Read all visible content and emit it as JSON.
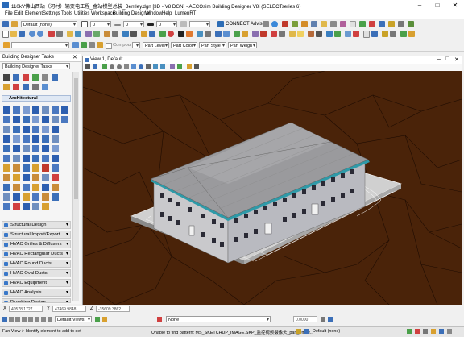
{
  "title": "110kV佛山西站（河村）输变电工程_金站模型总装_Bentley.dgn [3D - V8 DGN] - AECOsim Building Designer V8i (SELECTseries 6)",
  "menu": [
    "File",
    "Edit",
    "Element",
    "Settings",
    "Tools",
    "Utilities",
    "Workspace",
    "Building Designer",
    "Window",
    "Help",
    "LumenRT"
  ],
  "toolbar": {
    "level_display": "Default (none)",
    "color_value": "0",
    "style_value": "0",
    "weight_value": "0",
    "connect_label": "CONNECT Advisor",
    "compound_label": "Compound",
    "part_level": "Part Level",
    "part_color": "Part Color",
    "part_style": "Part Style",
    "part_weigh": "Part Weigh"
  },
  "tasks": {
    "header": "Building Designer Tasks",
    "dropdown": "Building Designer Tasks",
    "section_open": "Architectural",
    "categories": [
      "Structural Design",
      "Structural Import/Export",
      "HVAC Grilles & Diffusers",
      "HVAC Rectangular Ducts",
      "HVAC Round Ducts",
      "HVAC Oval Ducts",
      "HVAC Equipment",
      "HVAC Analysis",
      "Plumbing Design"
    ]
  },
  "view": {
    "title": "View 1, Default"
  },
  "coords": {
    "x_label": "X",
    "x_value": "40578.1727",
    "y_label": "Y",
    "y_value": "47469.9848",
    "z_label": "Z",
    "z_value": "-35609.3862"
  },
  "views_row": {
    "views_label": "Default Views",
    "none_label": "None",
    "value": "0.0000"
  },
  "status": {
    "left": "Fan View > Identify element to add to set",
    "middle": "Unable to find pattern: MS_SKETCHUP_IMAGE.SKP_监控视频摄像头_pan_off1of...",
    "level": "Default (none)"
  },
  "colors": {
    "viewport_bg": "#4a2309",
    "accent": "#2d6db5"
  }
}
